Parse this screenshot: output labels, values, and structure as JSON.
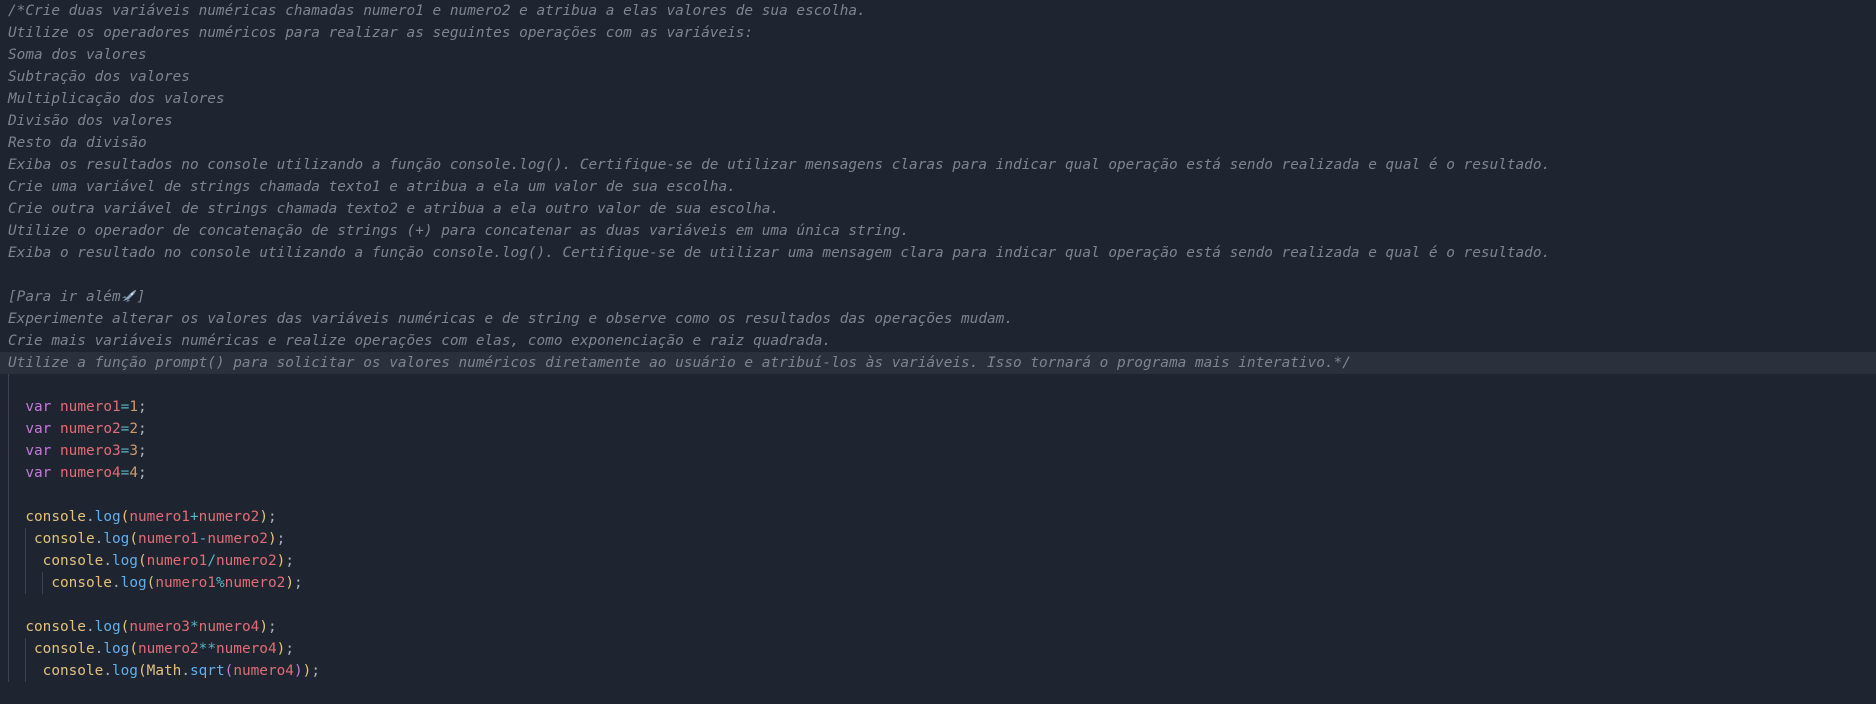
{
  "comment": {
    "lines": [
      "/*Crie duas variáveis numéricas chamadas numero1 e numero2 e atribua a elas valores de sua escolha.",
      "Utilize os operadores numéricos para realizar as seguintes operações com as variáveis:",
      "Soma dos valores",
      "Subtração dos valores",
      "Multiplicação dos valores",
      "Divisão dos valores",
      "Resto da divisão",
      "Exiba os resultados no console utilizando a função console.log(). Certifique-se de utilizar mensagens claras para indicar qual operação está sendo realizada e qual é o resultado.",
      "Crie uma variável de strings chamada texto1 e atribua a ela um valor de sua escolha.",
      "Crie outra variável de strings chamada texto2 e atribua a ela outro valor de sua escolha.",
      "Utilize o operador de concatenação de strings (+) para concatenar as duas variáveis em uma única string.",
      "Exiba o resultado no console utilizando a função console.log(). Certifique-se de utilizar uma mensagem clara para indicar qual operação está sendo realizada e qual é o resultado.",
      "",
      "[Para ir além",
      "Experimente alterar os valores das variáveis numéricas e de string e observe como os resultados das operações mudam.",
      "Crie mais variáveis numéricas e realize operações com elas, como exponenciação e raiz quadrada.",
      "Utilize a função prompt() para solicitar os valores numéricos diretamente ao usuário e atribuí-los às variáveis. Isso tornará o programa mais interativo.*/"
    ],
    "para_ir_alem_close": "]"
  },
  "code": {
    "kw_var": "var",
    "vars": [
      "numero1",
      "numero2",
      "numero3",
      "numero4"
    ],
    "values": [
      "1",
      "2",
      "3",
      "4"
    ],
    "eq": "=",
    "semi": ";",
    "console": "console",
    "dot": ".",
    "log": "log",
    "math": "Math",
    "sqrt": "sqrt",
    "ops": [
      "+",
      "-",
      "/",
      "%",
      "*",
      "**"
    ]
  }
}
